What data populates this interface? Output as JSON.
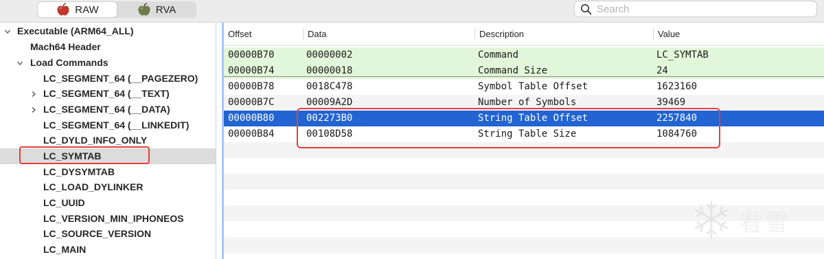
{
  "toolbar": {
    "modes": [
      {
        "label": "RAW",
        "icon": "apple-raw-icon",
        "active": true
      },
      {
        "label": "RVA",
        "icon": "apple-rva-icon",
        "active": false
      }
    ],
    "search_placeholder": "Search"
  },
  "sidebar": {
    "items": [
      {
        "label": "Executable  (ARM64_ALL)",
        "depth": 0,
        "disclosure": "expanded"
      },
      {
        "label": "Mach64 Header",
        "depth": 1,
        "disclosure": "none"
      },
      {
        "label": "Load Commands",
        "depth": 1,
        "disclosure": "expanded"
      },
      {
        "label": "LC_SEGMENT_64 (__PAGEZERO)",
        "depth": 2,
        "disclosure": "none"
      },
      {
        "label": "LC_SEGMENT_64 (__TEXT)",
        "depth": 2,
        "disclosure": "collapsed"
      },
      {
        "label": "LC_SEGMENT_64 (__DATA)",
        "depth": 2,
        "disclosure": "collapsed"
      },
      {
        "label": "LC_SEGMENT_64 (__LINKEDIT)",
        "depth": 2,
        "disclosure": "none"
      },
      {
        "label": "LC_DYLD_INFO_ONLY",
        "depth": 2,
        "disclosure": "none"
      },
      {
        "label": "LC_SYMTAB",
        "depth": 2,
        "disclosure": "none",
        "selected": true
      },
      {
        "label": "LC_DYSYMTAB",
        "depth": 2,
        "disclosure": "none"
      },
      {
        "label": "LC_LOAD_DYLINKER",
        "depth": 2,
        "disclosure": "none"
      },
      {
        "label": "LC_UUID",
        "depth": 2,
        "disclosure": "none"
      },
      {
        "label": "LC_VERSION_MIN_IPHONEOS",
        "depth": 2,
        "disclosure": "none"
      },
      {
        "label": "LC_SOURCE_VERSION",
        "depth": 2,
        "disclosure": "none"
      },
      {
        "label": "LC_MAIN",
        "depth": 2,
        "disclosure": "none"
      }
    ]
  },
  "table": {
    "columns": [
      "Offset",
      "Data",
      "Description",
      "Value"
    ],
    "rows": [
      {
        "offset": "00000B70",
        "data": "00000002",
        "description": "Command",
        "value": "LC_SYMTAB",
        "style": "green"
      },
      {
        "offset": "00000B74",
        "data": "00000018",
        "description": "Command Size",
        "value": "24",
        "style": "green"
      },
      {
        "offset": "00000B78",
        "data": "0018C478",
        "description": "Symbol Table Offset",
        "value": "1623160",
        "style": "plain"
      },
      {
        "offset": "00000B7C",
        "data": "00009A2D",
        "description": "Number of Symbols",
        "value": "39469",
        "style": "alt"
      },
      {
        "offset": "00000B80",
        "data": "002273B0",
        "description": "String Table Offset",
        "value": "2257840",
        "style": "selected"
      },
      {
        "offset": "00000B84",
        "data": "00108D58",
        "description": "String Table Size",
        "value": "1084760",
        "style": "alt"
      }
    ]
  },
  "watermark": {
    "icon": "snowflake-icon",
    "text": "看雪"
  },
  "colors": {
    "selection": "#2264d1",
    "highlight_box": "#e0413b",
    "green_row": "#e2f7d9",
    "alt_row": "#f4f4f4"
  }
}
